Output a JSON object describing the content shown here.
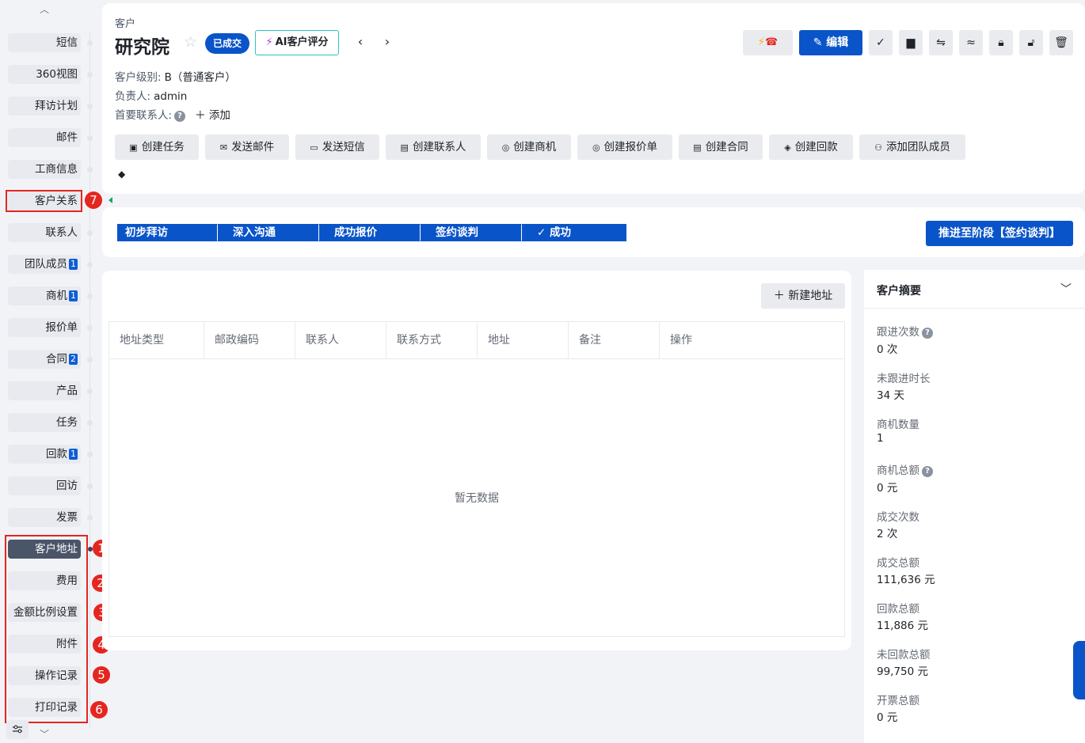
{
  "nav": {
    "items": [
      {
        "label": "短信",
        "badge": ""
      },
      {
        "label": "360视图",
        "badge": ""
      },
      {
        "label": "拜访计划",
        "badge": ""
      },
      {
        "label": "邮件",
        "badge": ""
      },
      {
        "label": "工商信息",
        "badge": ""
      },
      {
        "label": "客户关系",
        "badge": ""
      },
      {
        "label": "联系人",
        "badge": ""
      },
      {
        "label": "团队成员",
        "badge": "1"
      },
      {
        "label": "商机",
        "badge": "1"
      },
      {
        "label": "报价单",
        "badge": ""
      },
      {
        "label": "合同",
        "badge": "2"
      },
      {
        "label": "产品",
        "badge": ""
      },
      {
        "label": "任务",
        "badge": ""
      },
      {
        "label": "回款",
        "badge": "1"
      },
      {
        "label": "回访",
        "badge": ""
      },
      {
        "label": "发票",
        "badge": ""
      },
      {
        "label": "客户地址",
        "badge": ""
      },
      {
        "label": "费用",
        "badge": ""
      },
      {
        "label": "金额比例设置",
        "badge": ""
      },
      {
        "label": "附件",
        "badge": ""
      },
      {
        "label": "操作记录",
        "badge": ""
      },
      {
        "label": "打印记录",
        "badge": ""
      }
    ],
    "annotations": [
      "1",
      "2",
      "3",
      "4",
      "5",
      "6",
      "7"
    ]
  },
  "header": {
    "breadcrumb": "客户",
    "title": "研究院",
    "status_badge": "已成交",
    "ai_button": "AI客户评分",
    "level_label": "客户级别:",
    "level_value": "B（普通客户）",
    "owner_label": "负责人:",
    "owner_value": "admin",
    "primary_contact_label": "首要联系人:",
    "add_label": "添加",
    "edit_button": "编辑",
    "actions": [
      {
        "label": "创建任务",
        "icon": "calendar-icon"
      },
      {
        "label": "发送邮件",
        "icon": "mail-icon"
      },
      {
        "label": "发送短信",
        "icon": "sms-icon"
      },
      {
        "label": "创建联系人",
        "icon": "contact-icon"
      },
      {
        "label": "创建商机",
        "icon": "opportunity-icon"
      },
      {
        "label": "创建报价单",
        "icon": "quote-icon"
      },
      {
        "label": "创建合同",
        "icon": "contract-icon"
      },
      {
        "label": "创建回款",
        "icon": "payment-icon"
      },
      {
        "label": "添加团队成员",
        "icon": "team-icon"
      }
    ]
  },
  "stages": {
    "items": [
      "初步拜访",
      "深入沟通",
      "成功报价",
      "签约谈判",
      "成功"
    ],
    "advance_button": "推进至阶段【签约谈判】"
  },
  "address_table": {
    "new_button": "新建地址",
    "columns": [
      "地址类型",
      "邮政编码",
      "联系人",
      "联系方式",
      "地址",
      "备注",
      "操作"
    ],
    "empty_text": "暂无数据"
  },
  "summary": {
    "title": "客户摘要",
    "items": [
      {
        "label": "跟进次数",
        "value": "0 次",
        "help": true
      },
      {
        "label": "未跟进时长",
        "value": "34 天",
        "help": false
      },
      {
        "label": "商机数量",
        "value": "1",
        "help": false
      },
      {
        "label": "商机总额",
        "value": "0 元",
        "help": true
      },
      {
        "label": "成交次数",
        "value": "2 次",
        "help": false
      },
      {
        "label": "成交总额",
        "value": "111,636 元",
        "help": false
      },
      {
        "label": "回款总额",
        "value": "11,886 元",
        "help": false
      },
      {
        "label": "未回款总额",
        "value": "99,750 元",
        "help": false
      },
      {
        "label": "开票总额",
        "value": "0 元",
        "help": false
      }
    ]
  },
  "colors": {
    "primary": "#0a54c9",
    "annotation": "#e5261f",
    "active_nav": "#4b5568"
  }
}
